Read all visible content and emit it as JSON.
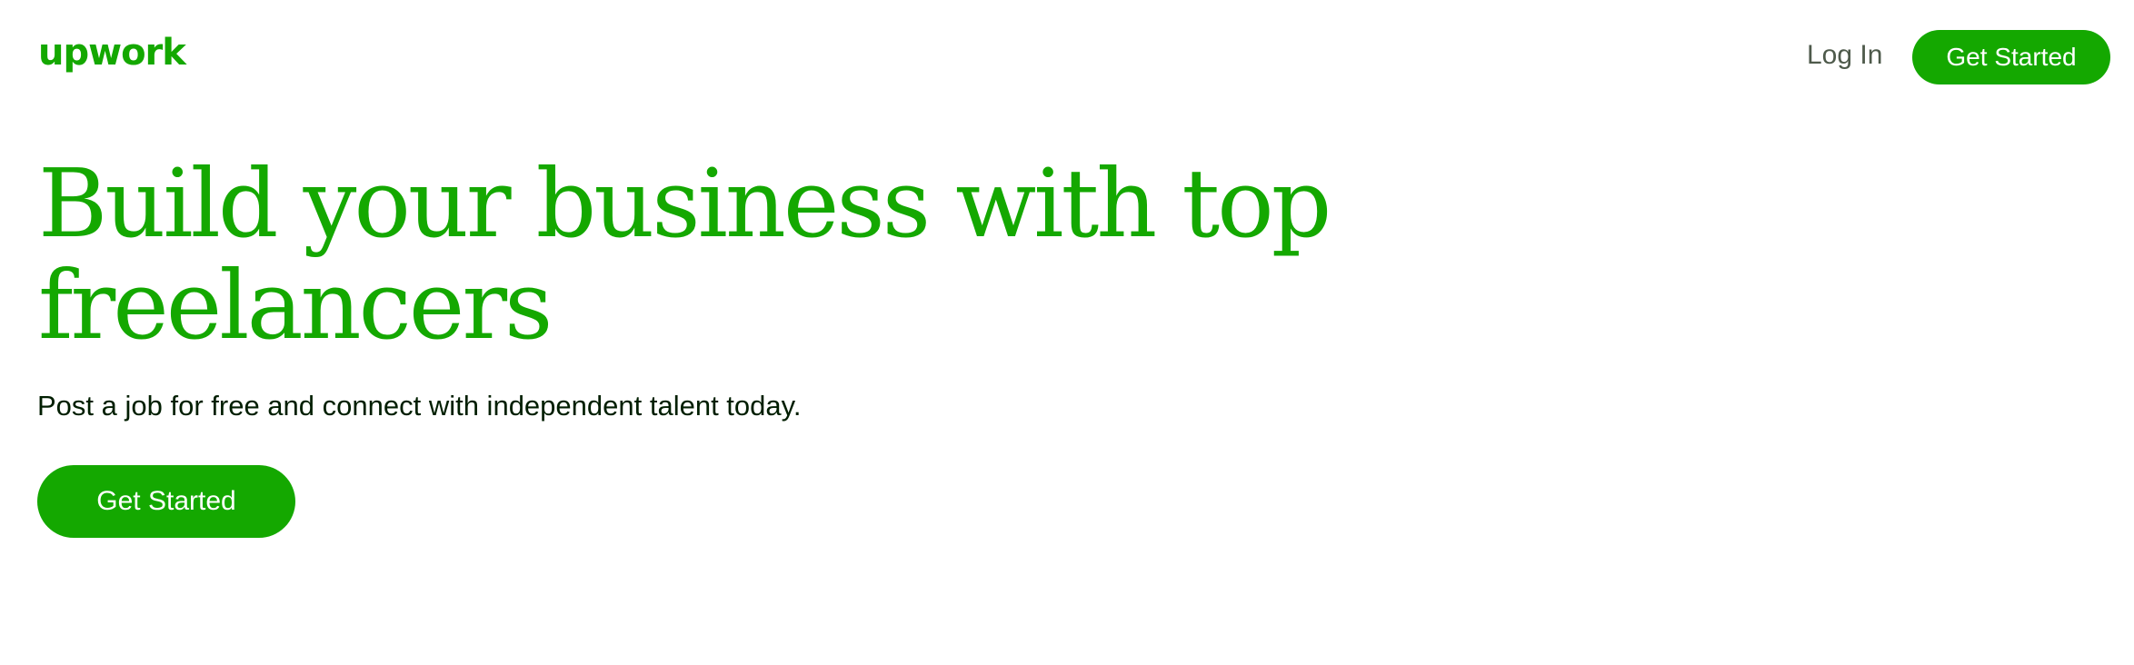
{
  "header": {
    "logo_text": "upwork",
    "login_label": "Log In",
    "cta_label": "Get Started"
  },
  "hero": {
    "title": "Build your business with top freelancers",
    "subtitle": "Post a job for free and connect with independent talent today.",
    "cta_label": "Get Started"
  },
  "colors": {
    "brand_green": "#14a800",
    "text_dark": "#001e00",
    "text_muted": "#4e5a4b",
    "background": "#ffffff"
  }
}
